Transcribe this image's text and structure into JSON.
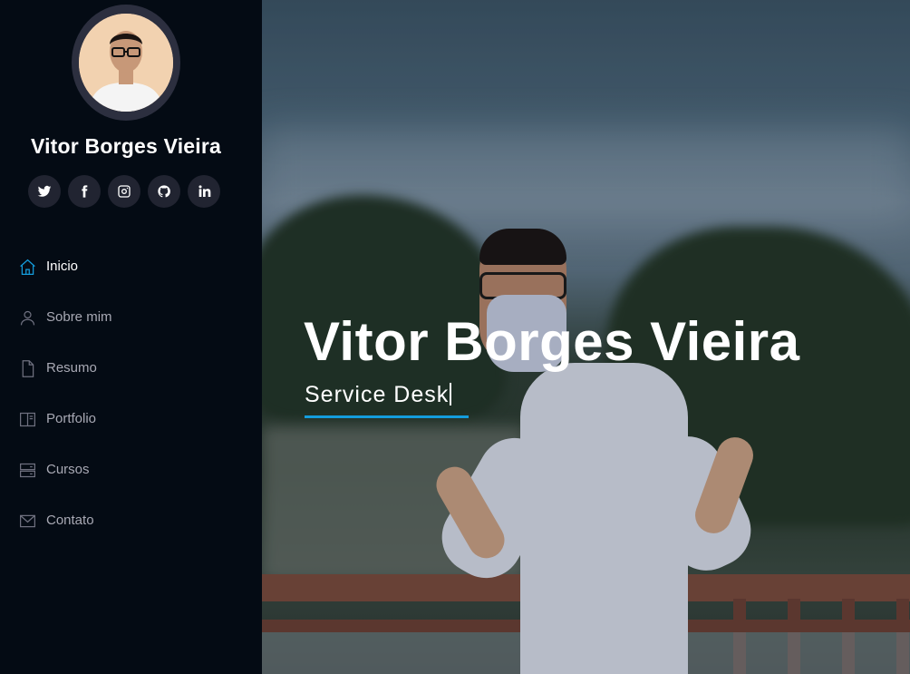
{
  "profile": {
    "name": "Vitor Borges Vieira"
  },
  "social": [
    {
      "icon": "twitter-icon"
    },
    {
      "icon": "facebook-icon"
    },
    {
      "icon": "instagram-icon"
    },
    {
      "icon": "github-icon"
    },
    {
      "icon": "linkedin-icon"
    }
  ],
  "nav": {
    "items": [
      {
        "label": "Inicio",
        "icon": "home-icon",
        "active": true
      },
      {
        "label": "Sobre mim",
        "icon": "person-icon"
      },
      {
        "label": "Resumo",
        "icon": "document-icon"
      },
      {
        "label": "Portfolio",
        "icon": "book-icon"
      },
      {
        "label": "Cursos",
        "icon": "server-icon"
      },
      {
        "label": "Contato",
        "icon": "envelope-icon"
      }
    ]
  },
  "hero": {
    "title": "Vitor Borges Vieira",
    "subtitle": "Service Desk"
  },
  "colors": {
    "accent": "#149ddd",
    "sidebar_bg": "#040b14",
    "social_bg": "#212431"
  }
}
